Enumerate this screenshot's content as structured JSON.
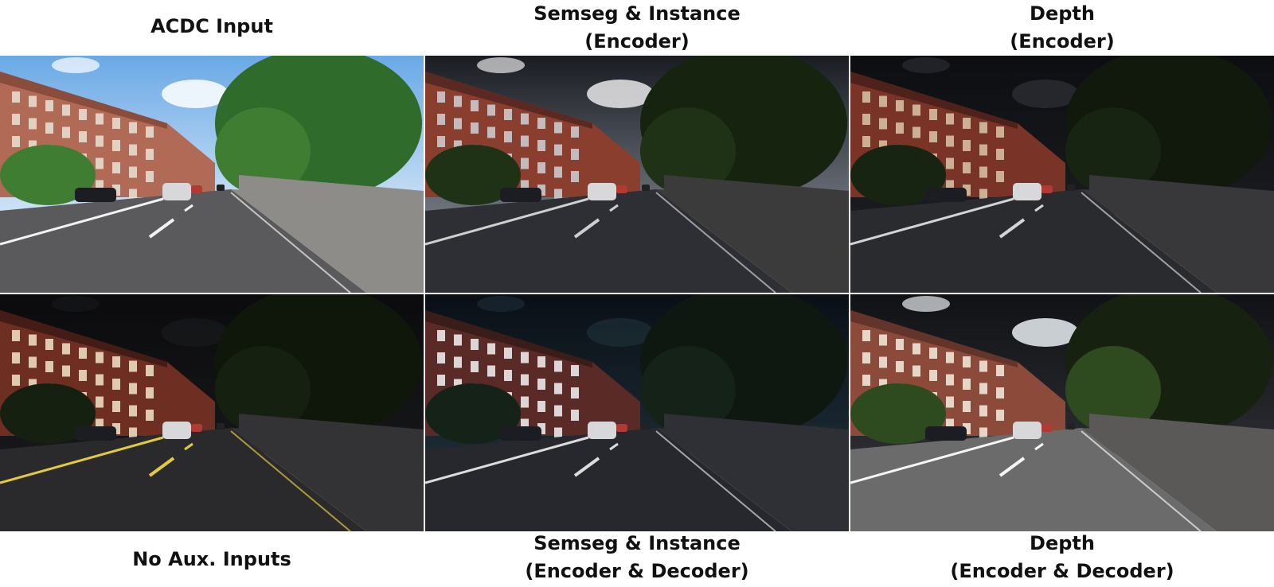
{
  "panels": [
    {
      "caption": [
        "ACDC Input"
      ],
      "scene": "day"
    },
    {
      "caption": [
        "Semseg & Instance",
        "(Encoder)"
      ],
      "scene": "night-cloudy"
    },
    {
      "caption": [
        "Depth",
        "(Encoder)"
      ],
      "scene": "night-dark"
    },
    {
      "caption": [
        "No Aux. Inputs"
      ],
      "scene": "night-dark-lit"
    },
    {
      "caption": [
        "Semseg & Instance",
        "(Encoder & Decoder)"
      ],
      "scene": "night-blue"
    },
    {
      "caption": [
        "Depth",
        "(Encoder & Decoder)"
      ],
      "scene": "night-bright"
    }
  ]
}
